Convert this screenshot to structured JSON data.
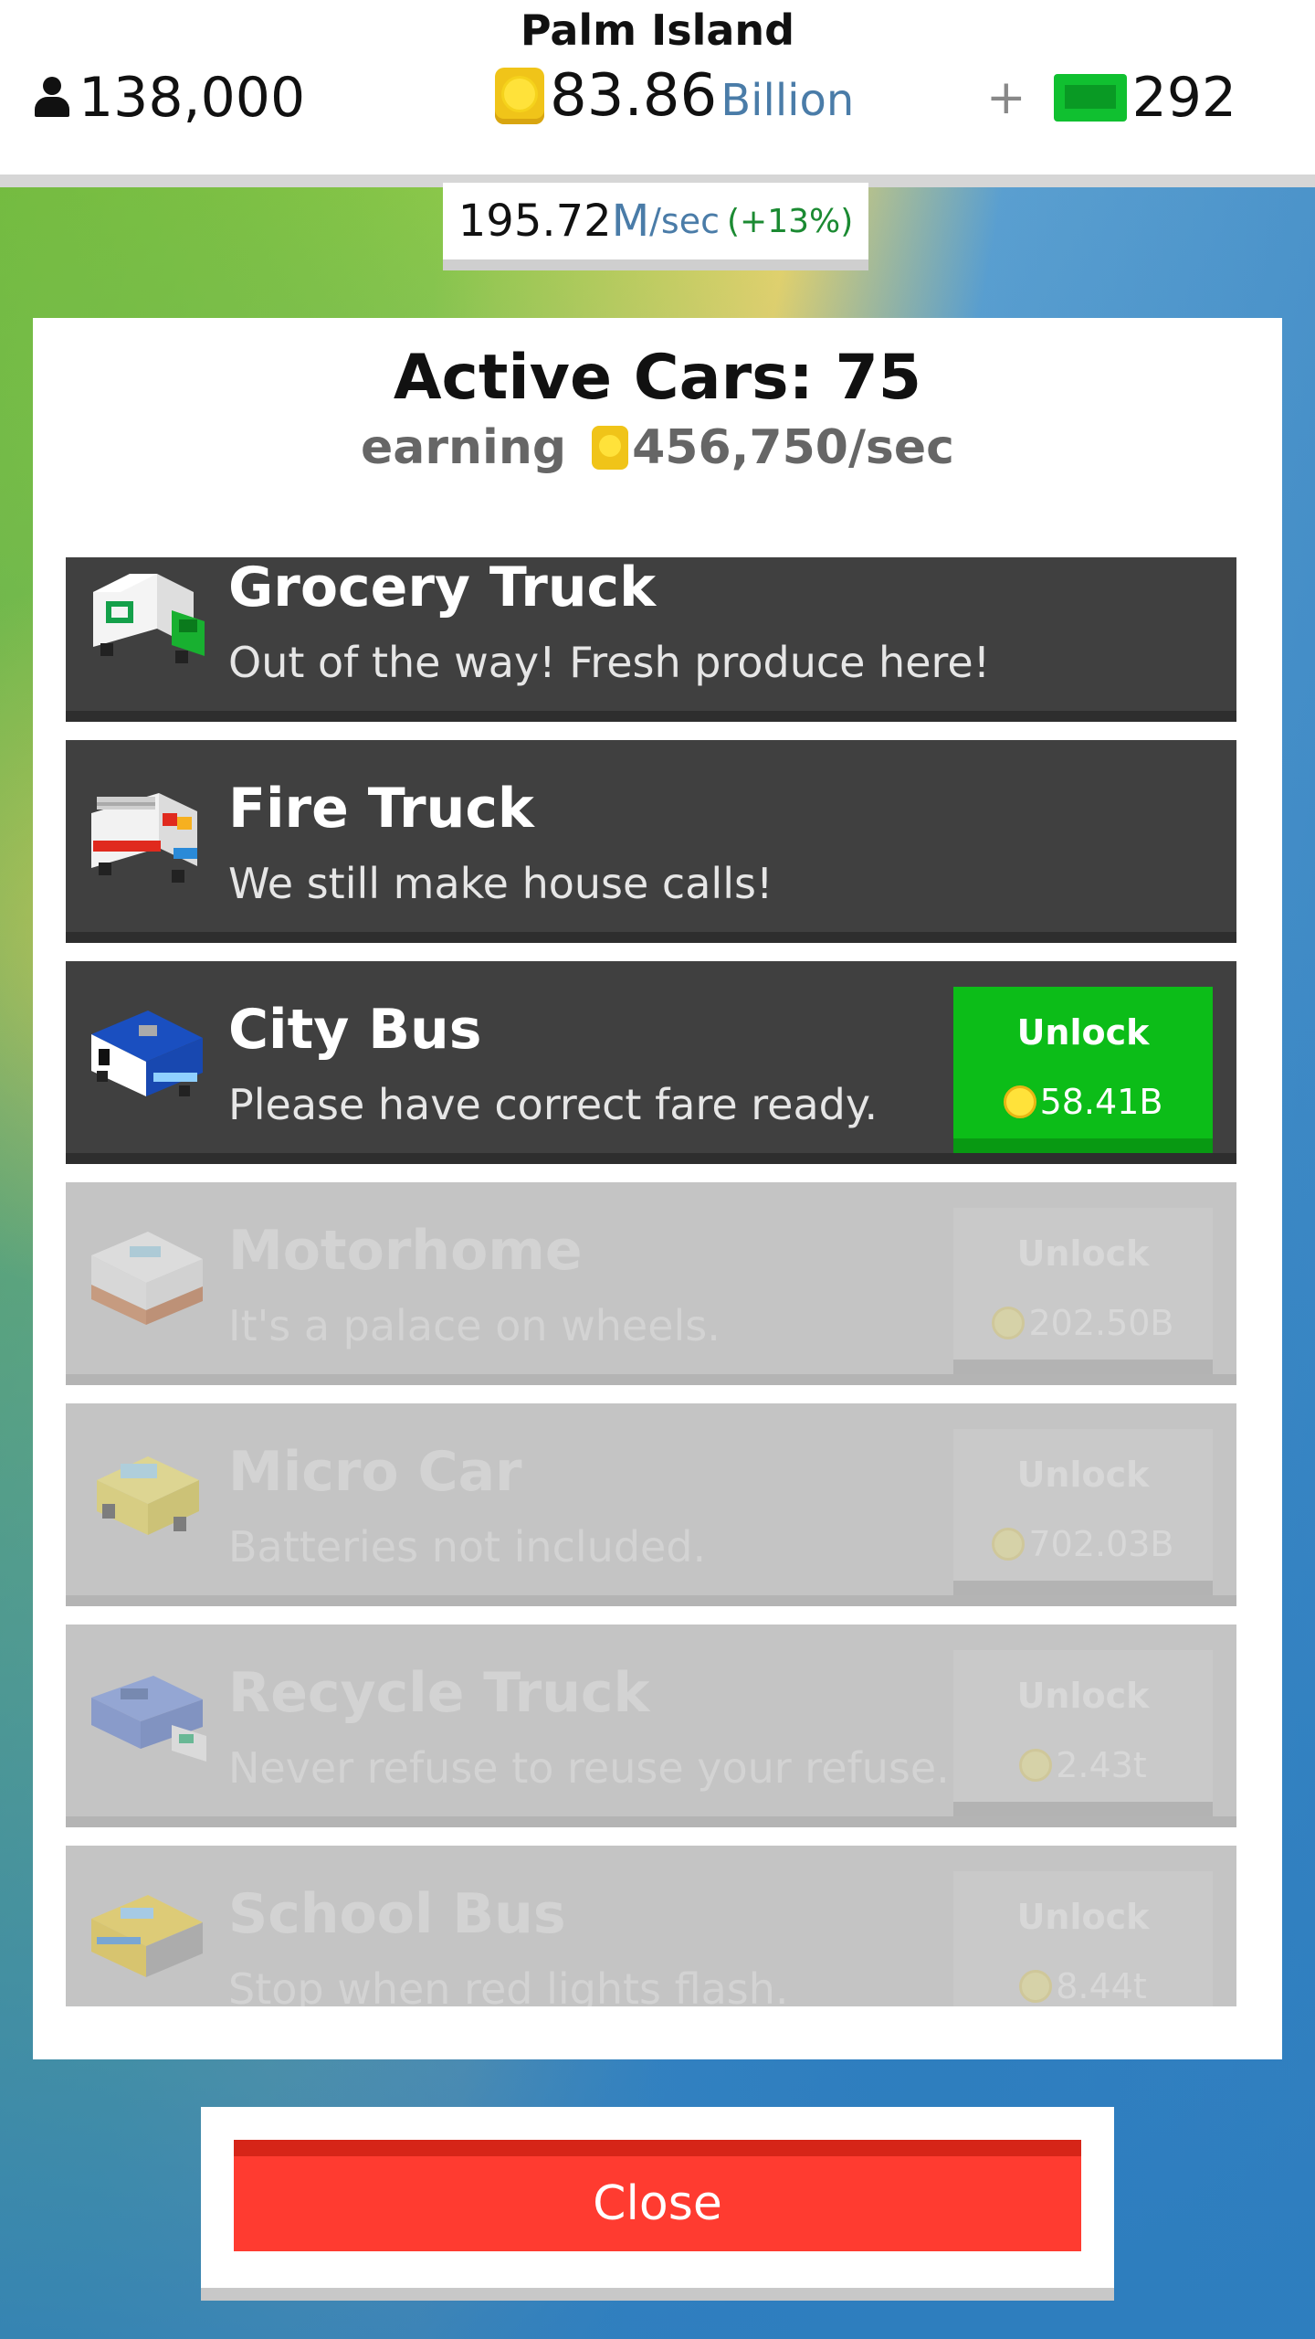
{
  "header": {
    "island_name": "Palm Island",
    "population": "138,000",
    "money_value": "83.86",
    "money_unit": "Billion",
    "plus": "+",
    "gems": "292"
  },
  "rate": {
    "value": "195.72",
    "unit": "M",
    "per": "/sec",
    "bonus": "(+13%)"
  },
  "panel": {
    "title": "Active Cars: 75",
    "earning_label": "earning",
    "earning_value": "456,750/sec"
  },
  "vehicles": [
    {
      "name": "Grocery Truck",
      "desc": "Out of the way! Fresh produce here!",
      "locked": false,
      "icon": "grocery-truck-icon"
    },
    {
      "name": "Fire Truck",
      "desc": "We still make house calls!",
      "locked": false,
      "icon": "fire-truck-icon"
    },
    {
      "name": "City Bus",
      "desc": "Please have correct fare ready.",
      "locked": false,
      "unlock_label": "Unlock",
      "price": "58.41B",
      "icon": "city-bus-icon"
    },
    {
      "name": "Motorhome",
      "desc": "It's a palace on wheels.",
      "locked": true,
      "unlock_label": "Unlock",
      "price": "202.50B",
      "icon": "motorhome-icon"
    },
    {
      "name": "Micro Car",
      "desc": "Batteries not included.",
      "locked": true,
      "unlock_label": "Unlock",
      "price": "702.03B",
      "icon": "micro-car-icon"
    },
    {
      "name": "Recycle Truck",
      "desc": "Never refuse to reuse your refuse.",
      "locked": true,
      "unlock_label": "Unlock",
      "price": "2.43t",
      "icon": "recycle-truck-icon"
    },
    {
      "name": "School Bus",
      "desc": "Stop when red lights flash.",
      "locked": true,
      "unlock_label": "Unlock",
      "price": "8.44t",
      "icon": "school-bus-icon"
    }
  ],
  "close_label": "Close",
  "colors": {
    "unlock_green": "#0cbd18",
    "close_red": "#ff3b30",
    "row_dark": "#404040",
    "row_locked": "#c4c4c4"
  }
}
